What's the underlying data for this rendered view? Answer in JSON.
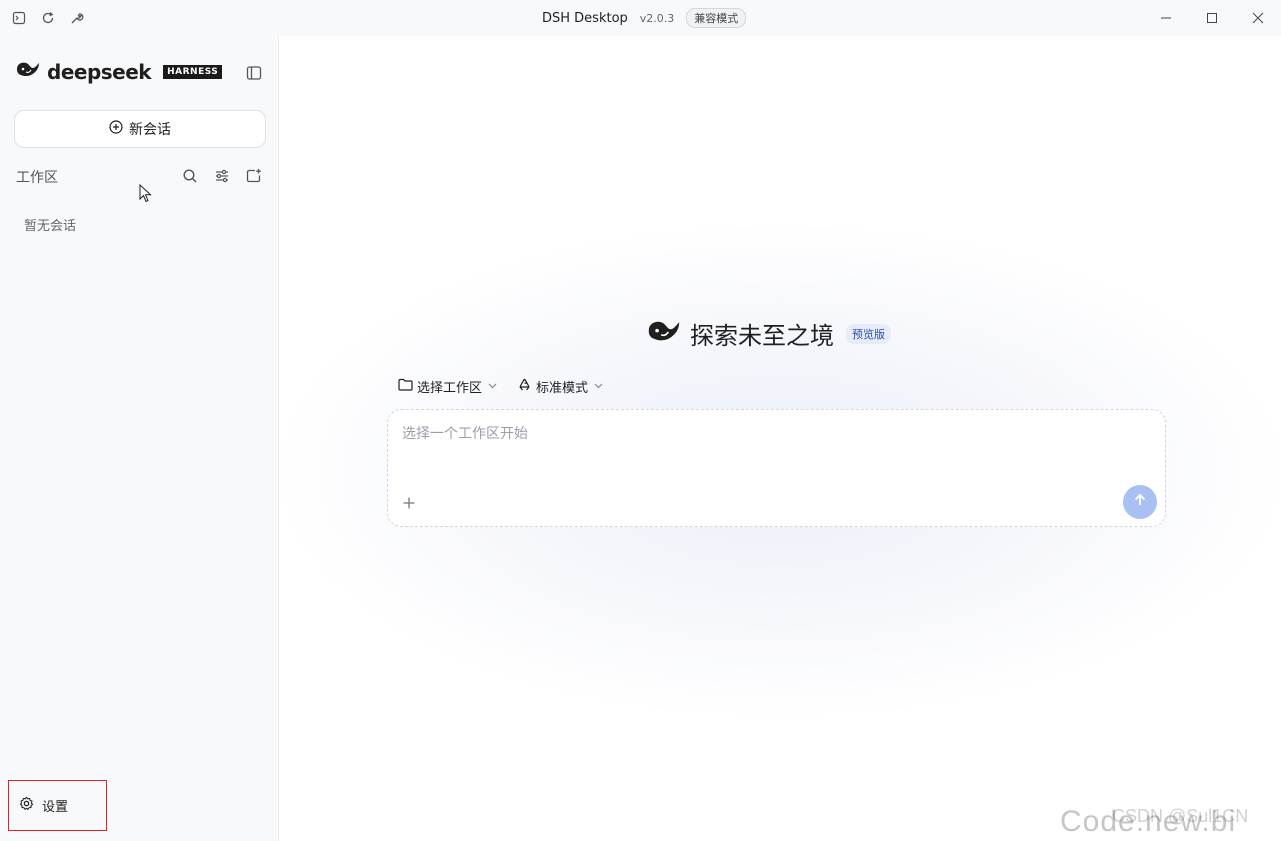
{
  "titlebar": {
    "title": "DSH Desktop",
    "version": "v2.0.3",
    "compat_badge": "兼容模式",
    "left_icons": [
      "terminal-icon",
      "refresh-icon",
      "wrench-icon"
    ],
    "controls": [
      "minimize",
      "maximize",
      "close"
    ]
  },
  "sidebar": {
    "brand": "deepseek",
    "brand_badge": "HARNESS",
    "new_chat_label": "新会话",
    "workspace_label": "工作区",
    "workspace_tools": [
      "search-icon",
      "filter-icon",
      "new-folder-icon"
    ],
    "empty_text": "暂无会话",
    "settings_label": "设置"
  },
  "main": {
    "hero_title": "探索未至之境",
    "preview_badge": "预览版",
    "workspace_selector": "选择工作区",
    "mode_selector": "标准模式",
    "composer_placeholder": "选择一个工作区开始"
  },
  "watermark": {
    "main": "Code.new.bi",
    "sub": "CSDN @Sul1CN"
  },
  "colors": {
    "accent": "#a9c0f2",
    "sidebar_bg": "#f8f9fb",
    "highlight_box": "#e0202a",
    "preview_badge_bg": "#e6ecfa"
  }
}
